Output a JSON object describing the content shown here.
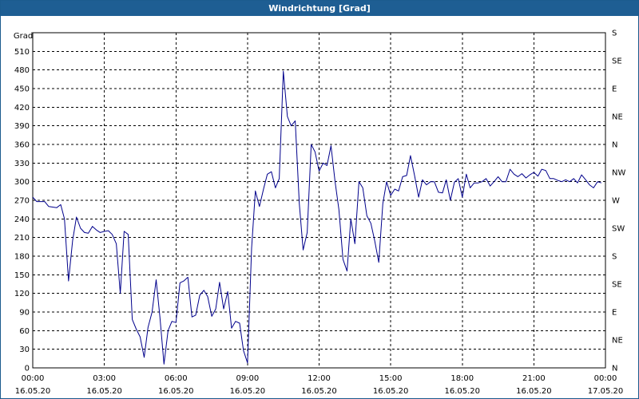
{
  "window": {
    "title": "Windrichtung [Grad]"
  },
  "chart_data": {
    "type": "line",
    "title": "Windrichtung [Grad]",
    "ylabel": "Grad",
    "ylim": [
      0,
      540
    ],
    "grid": true,
    "y_ticks": [
      0,
      30,
      60,
      90,
      120,
      150,
      180,
      210,
      240,
      270,
      300,
      330,
      360,
      390,
      420,
      450,
      480,
      510
    ],
    "y2_ticks": [
      "N",
      "NE",
      "E",
      "SE",
      "S",
      "SW",
      "W",
      "NW",
      "N",
      "NE",
      "E",
      "SE",
      "S"
    ],
    "x_range_hours": [
      0,
      24
    ],
    "x_ticks": [
      {
        "time": "00:00",
        "date": "16.05.20"
      },
      {
        "time": "03:00",
        "date": "16.05.20"
      },
      {
        "time": "06:00",
        "date": "16.05.20"
      },
      {
        "time": "09:00",
        "date": "16.05.20"
      },
      {
        "time": "12:00",
        "date": "16.05.20"
      },
      {
        "time": "15:00",
        "date": "16.05.20"
      },
      {
        "time": "18:00",
        "date": "16.05.20"
      },
      {
        "time": "21:00",
        "date": "16.05.20"
      },
      {
        "time": "00:00",
        "date": "17.05.20"
      }
    ],
    "series": [
      {
        "color": "#00008b",
        "x_hours": [
          0.0,
          0.17,
          0.5,
          0.67,
          1.0,
          1.17,
          1.33,
          1.5,
          1.67,
          1.83,
          2.0,
          2.17,
          2.33,
          2.5,
          2.67,
          2.83,
          3.0,
          3.17,
          3.33,
          3.5,
          3.67,
          3.83,
          4.0,
          4.17,
          4.33,
          4.5,
          4.67,
          4.83,
          5.0,
          5.17,
          5.33,
          5.5,
          5.67,
          5.83,
          6.0,
          6.17,
          6.33,
          6.5,
          6.67,
          6.83,
          7.0,
          7.17,
          7.33,
          7.5,
          7.67,
          7.83,
          8.0,
          8.17,
          8.33,
          8.5,
          8.67,
          8.83,
          9.0,
          9.17,
          9.33,
          9.5,
          9.67,
          9.83,
          10.0,
          10.17,
          10.33,
          10.5,
          10.67,
          10.83,
          11.0,
          11.17,
          11.33,
          11.5,
          11.67,
          11.83,
          12.0,
          12.17,
          12.33,
          12.5,
          12.67,
          12.83,
          13.0,
          13.17,
          13.33,
          13.5,
          13.67,
          13.83,
          14.0,
          14.17,
          14.33,
          14.5,
          14.67,
          14.83,
          15.0,
          15.17,
          15.33,
          15.5,
          15.67,
          15.83,
          16.0,
          16.17,
          16.33,
          16.5,
          16.67,
          16.83,
          17.0,
          17.17,
          17.33,
          17.5,
          17.67,
          17.83,
          18.0,
          18.17,
          18.33,
          18.5,
          18.67,
          18.83,
          19.0,
          19.17,
          19.33,
          19.5,
          19.67,
          19.83,
          20.0,
          20.17,
          20.33,
          20.5,
          20.67,
          20.83,
          21.0,
          21.17,
          21.33,
          21.5,
          21.67,
          21.83,
          22.0,
          22.17,
          22.33,
          22.5,
          22.67,
          22.83,
          23.0,
          23.17,
          23.33,
          23.5,
          23.67,
          23.83
        ],
        "values": [
          275,
          268,
          268,
          260,
          258,
          263,
          240,
          140,
          205,
          243,
          225,
          218,
          217,
          228,
          222,
          218,
          220,
          221,
          215,
          200,
          120,
          220,
          215,
          78,
          63,
          50,
          17,
          65,
          90,
          142,
          82,
          6,
          60,
          75,
          73,
          137,
          140,
          146,
          82,
          85,
          117,
          125,
          115,
          83,
          95,
          138,
          95,
          123,
          64,
          75,
          72,
          28,
          8,
          193,
          285,
          260,
          288,
          312,
          316,
          290,
          305,
          478,
          405,
          390,
          398,
          265,
          190,
          218,
          360,
          348,
          317,
          330,
          326,
          358,
          300,
          255,
          175,
          156,
          240,
          200,
          300,
          290,
          245,
          233,
          205,
          170,
          265,
          300,
          278,
          288,
          285,
          308,
          310,
          342,
          310,
          275,
          303,
          295,
          300,
          300,
          283,
          282,
          303,
          270,
          299,
          305,
          275,
          312,
          290,
          298,
          298,
          300,
          305,
          293,
          300,
          308,
          300,
          300,
          320,
          312,
          308,
          313,
          306,
          311,
          315,
          309,
          320,
          318,
          305,
          305,
          302,
          300,
          303,
          300,
          305,
          298,
          311,
          303,
          295,
          290,
          300,
          298,
          297
        ]
      }
    ]
  }
}
